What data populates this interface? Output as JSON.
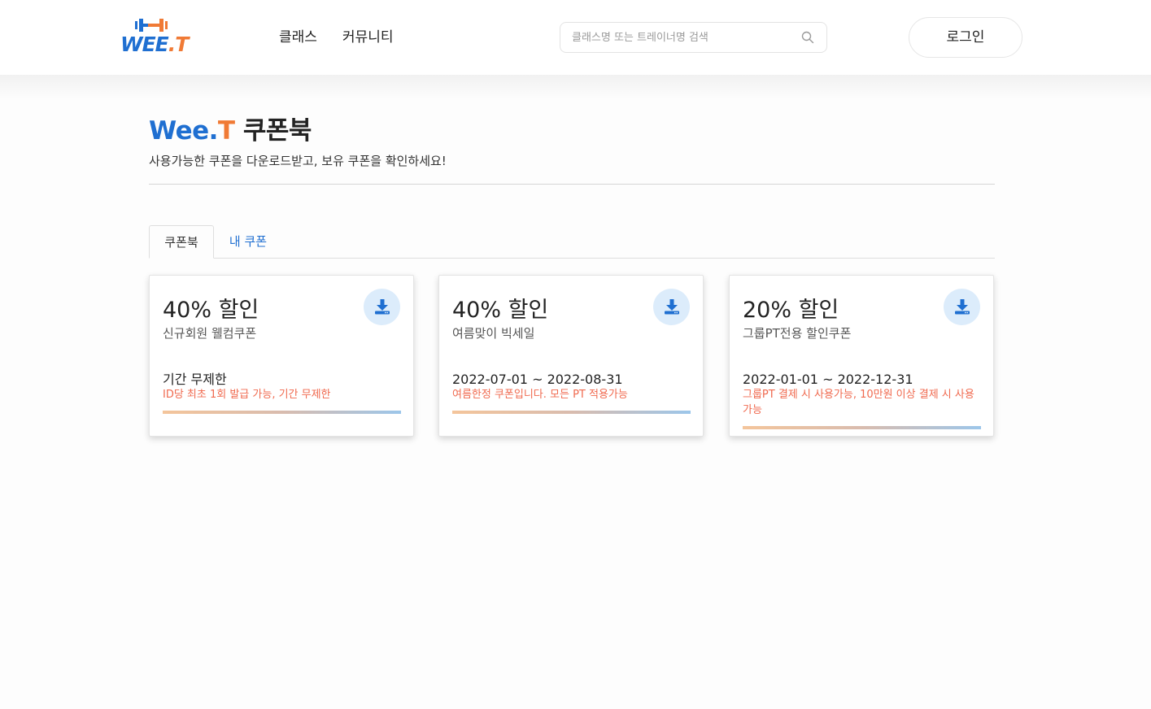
{
  "header": {
    "logo": {
      "main": "WEE",
      "dot": ".",
      "accent": "T"
    },
    "nav": [
      "클래스",
      "커뮤니티"
    ],
    "search": {
      "placeholder": "클래스명 또는 트레이너명 검색",
      "value": ""
    },
    "login_label": "로그인"
  },
  "page": {
    "title_brand": "Wee",
    "title_dot": ".",
    "title_t": "T",
    "title_rest": " 쿠폰북",
    "subtitle": "사용가능한 쿠폰을 다운로드받고, 보유 쿠폰을 확인하세요!"
  },
  "tabs": [
    {
      "label": "쿠폰북",
      "active": true
    },
    {
      "label": "내 쿠폰",
      "active": false
    }
  ],
  "coupons": [
    {
      "discount": "40% 할인",
      "name": "신규회원 웰컴쿠폰",
      "period": "기간 무제한",
      "description": "ID당 최초 1회 발급 가능, 기간 무제한"
    },
    {
      "discount": "40% 할인",
      "name": "여름맞이 빅세일",
      "period": "2022-07-01 ~ 2022-08-31",
      "description": "여름한정 쿠폰입니다. 모든 PT 적용가능"
    },
    {
      "discount": "20% 할인",
      "name": "그룹PT전용 할인쿠폰",
      "period": "2022-01-01 ~ 2022-12-31",
      "description": "그룹PT 결제 시 사용가능, 10만원 이상 결제 시 사용가능"
    }
  ],
  "colors": {
    "brand_blue": "#1f6fd1",
    "brand_orange": "#f07a35",
    "description_red": "#f06a4f",
    "download_bg": "#dcecfb"
  },
  "icons": {
    "search": "search-icon",
    "download": "download-icon",
    "logo": "dumbbell-icon"
  }
}
